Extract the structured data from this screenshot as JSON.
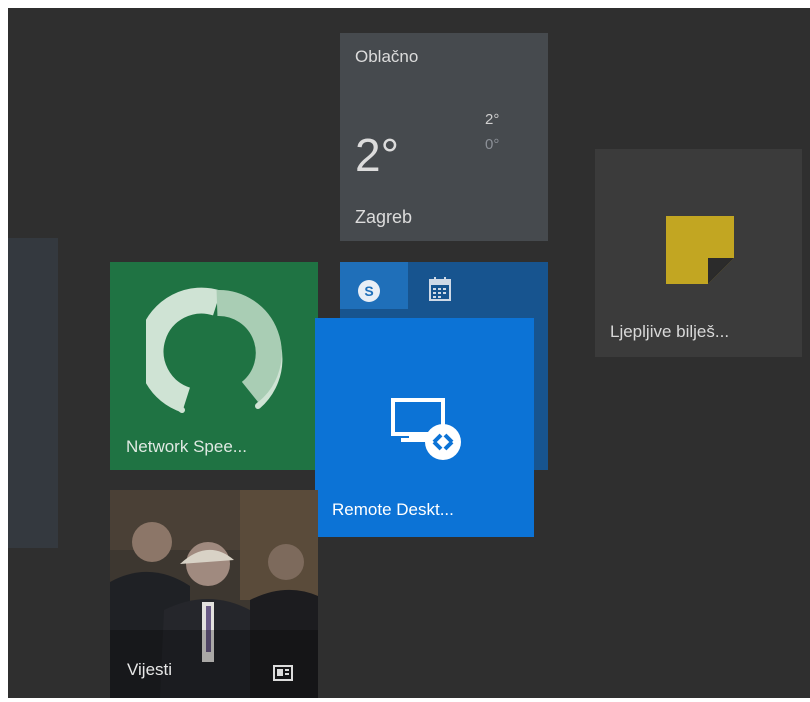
{
  "start_menu": {
    "tiles": {
      "weather": {
        "condition": "Oblačno",
        "temperature": "2°",
        "high": "2°",
        "low": "0°",
        "city": "Zagreb"
      },
      "sticky_notes": {
        "label": "Ljepljive bilješ...",
        "icon": "sticky-note-icon",
        "accent": "#c2a622"
      },
      "network_speed": {
        "label": "Network Spee...",
        "icon": "speedometer-gauge-icon",
        "background": "#1f7343"
      },
      "skype_calendar": {
        "icons": [
          "skype-icon",
          "calendar-icon"
        ],
        "background": "#17548f"
      },
      "remote_desktop": {
        "label": "Remote Deskt...",
        "icon": "remote-desktop-icon",
        "background": "#0c73d6"
      },
      "news": {
        "label": "Vijesti",
        "icon": "news-badge-icon"
      }
    }
  }
}
